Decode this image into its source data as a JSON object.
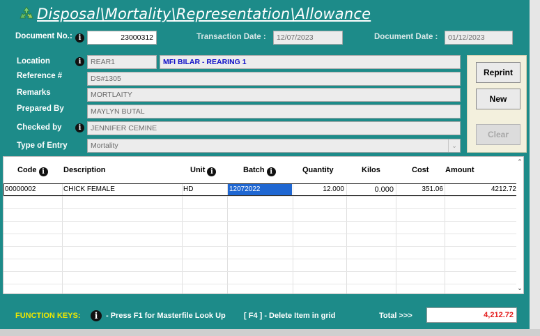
{
  "window": {
    "title": "Disposal\\Mortality\\Representation\\Allowance",
    "title_icon": "recycle-icon",
    "accent_color": "#1d8b89"
  },
  "header": {
    "document_no_label": "Document No.:",
    "document_no": "23000312",
    "transaction_date_label": "Transaction Date :",
    "transaction_date": "12/07/2023",
    "document_date_label": "Document Date :",
    "document_date": "01/12/2023"
  },
  "form": {
    "location_label": "Location",
    "location_code": "REAR1",
    "location_name": "MFI BILAR - REARING 1",
    "reference_label": "Reference #",
    "reference": "DS#1305",
    "remarks_label": "Remarks",
    "remarks": "MORTLAITY",
    "prepared_by_label": "Prepared By",
    "prepared_by": "MAYLYN BUTAL",
    "checked_by_label": "Checked by",
    "checked_by": "JENNIFER CEMINE",
    "type_of_entry_label": "Type of Entry",
    "type_of_entry": "Mortality"
  },
  "buttons": {
    "reprint": "Reprint",
    "new": "New",
    "clear": "Clear"
  },
  "grid": {
    "columns": {
      "code": "Code",
      "description": "Description",
      "unit": "Unit",
      "batch": "Batch",
      "quantity": "Quantity",
      "kilos": "Kilos",
      "cost": "Cost",
      "amount": "Amount"
    },
    "rows": [
      {
        "code": "00000002",
        "description": "CHICK FEMALE",
        "unit": "HD",
        "batch": "12072022",
        "quantity": "12.000",
        "kilos": "0.000",
        "cost": "351.06",
        "amount": "4212.72"
      }
    ]
  },
  "footer": {
    "function_keys_label": "FUNCTION KEYS:",
    "f1_hint": "- Press F1 for Masterfile Look Up",
    "f4_hint": "[ F4 ] - Delete Item in grid",
    "total_label": "Total >>>",
    "total": "4,212.72"
  }
}
